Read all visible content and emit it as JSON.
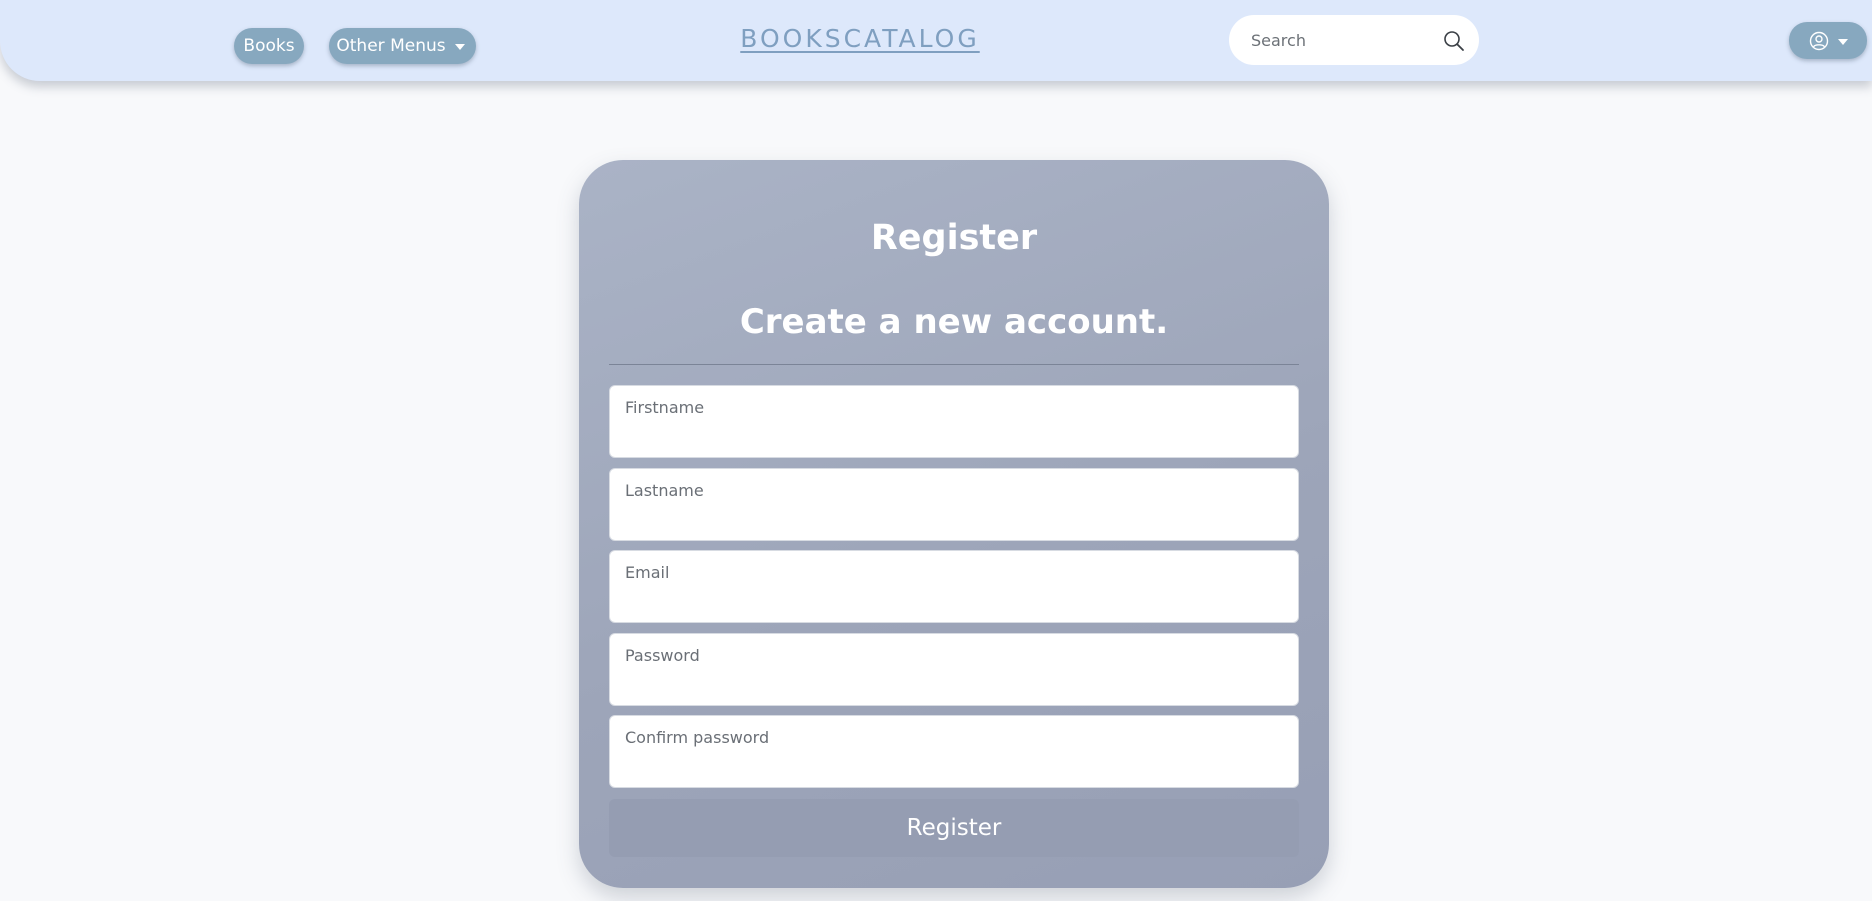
{
  "navbar": {
    "books_label": "Books",
    "other_menus_label": "Other Menus",
    "brand": "BOOKSCATALOG",
    "search_placeholder": "Search",
    "search_icon": "search-icon",
    "user_icon": "user-circle-icon"
  },
  "register": {
    "title": "Register",
    "subtitle": "Create a new account.",
    "fields": [
      {
        "label": "Firstname",
        "value": ""
      },
      {
        "label": "Lastname",
        "value": ""
      },
      {
        "label": "Email",
        "value": ""
      },
      {
        "label": "Password",
        "value": ""
      },
      {
        "label": "Confirm password",
        "value": ""
      }
    ],
    "submit_label": "Register"
  },
  "colors": {
    "navbar_bg": "#dde8fb",
    "pill_bg": "#87a8bf",
    "brand": "#7f9fc0",
    "card_bg": "#a1a9bd",
    "submit_bg": "#959db2",
    "page_bg": "#f8f9fb"
  }
}
